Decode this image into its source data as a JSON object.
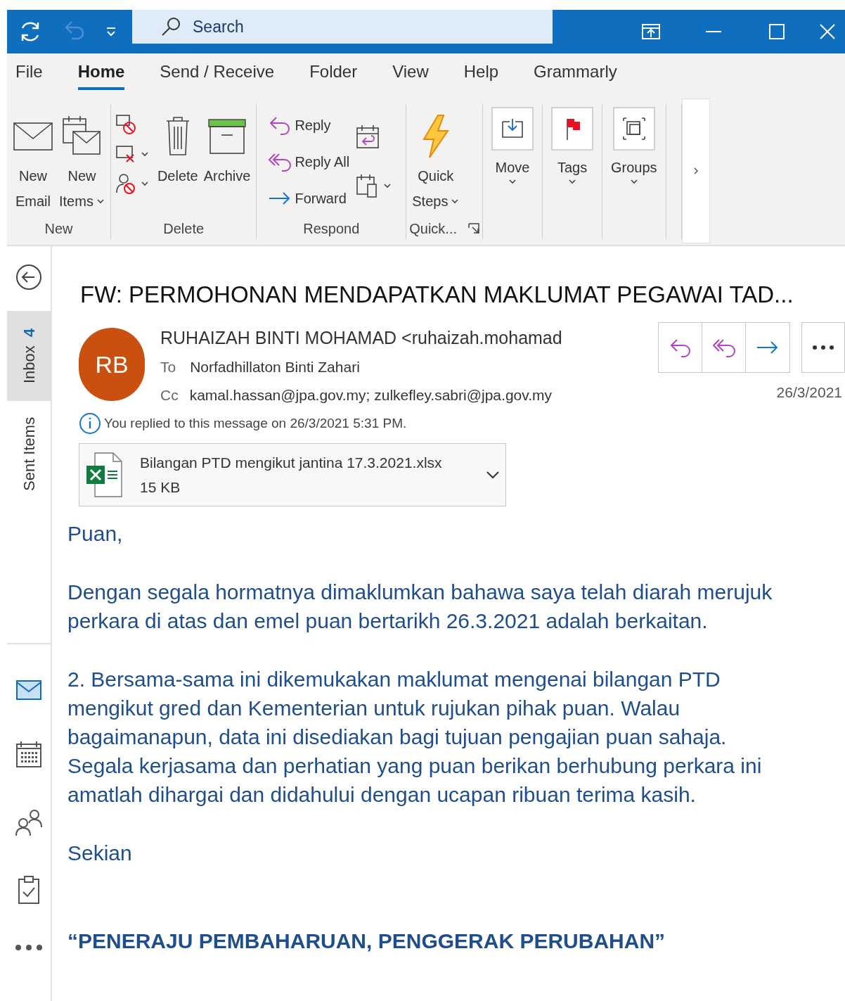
{
  "search": {
    "placeholder": "Search"
  },
  "ribbon_tabs": [
    {
      "label": "File",
      "selected": false
    },
    {
      "label": "Home",
      "selected": true
    },
    {
      "label": "Send / Receive",
      "selected": false
    },
    {
      "label": "Folder",
      "selected": false
    },
    {
      "label": "View",
      "selected": false
    },
    {
      "label": "Help",
      "selected": false
    },
    {
      "label": "Grammarly",
      "selected": false
    }
  ],
  "ribbon_groups": [
    {
      "label": "New",
      "items": [
        {
          "kind": "large",
          "lines": [
            "New",
            "Email"
          ],
          "dropdown": false
        },
        {
          "kind": "large",
          "lines": [
            "New",
            "Items"
          ],
          "dropdown": true
        }
      ]
    },
    {
      "label": "Delete",
      "items": [
        {
          "kind": "stack"
        },
        {
          "kind": "large",
          "lines": [
            "Delete"
          ],
          "dropdown": false
        },
        {
          "kind": "large",
          "lines": [
            "Archive"
          ],
          "dropdown": false
        }
      ]
    },
    {
      "label": "Respond",
      "items": [
        {
          "kind": "respond",
          "lines": [
            "Reply",
            "Reply All",
            "Forward"
          ]
        },
        {
          "kind": "stack2"
        }
      ]
    },
    {
      "label": "Quick...",
      "launcher": true,
      "items": [
        {
          "kind": "large",
          "lines": [
            "Quick",
            "Steps"
          ],
          "dropdown": true
        }
      ]
    },
    {
      "items": [
        {
          "kind": "boxed",
          "lines": [
            "Move"
          ],
          "dropdown": true
        }
      ]
    },
    {
      "items": [
        {
          "kind": "boxed",
          "lines": [
            "Tags"
          ],
          "dropdown": true
        }
      ]
    },
    {
      "items": [
        {
          "kind": "boxed",
          "lines": [
            "Groups"
          ],
          "dropdown": true
        }
      ]
    }
  ],
  "nav_folders": [
    {
      "label": "Inbox",
      "count": "4",
      "selected": true
    },
    {
      "label": "Sent Items",
      "selected": false
    }
  ],
  "nav_modules": [
    {
      "kind": "mail",
      "selected": true
    },
    {
      "kind": "calendar",
      "selected": false
    },
    {
      "kind": "people",
      "selected": false
    },
    {
      "kind": "tasks",
      "selected": false
    },
    {
      "kind": "more",
      "selected": false
    }
  ],
  "message": {
    "subject": "FW: PERMOHONAN MENDAPATKAN MAKLUMAT PEGAWAI TAD...",
    "initials": "RB",
    "sender": "RUHAIZAH BINTI MOHAMAD <ruhaizah.mohamad",
    "to_label": "To",
    "to": "Norfadhillaton Binti Zahari",
    "cc_label": "Cc",
    "cc": "kamal.hassan@jpa.gov.my; zulkefley.sabri@jpa.gov.my",
    "date": "26/3/2021",
    "info": "You replied to this message on 26/3/2021 5:31 PM.",
    "attachment": {
      "name": "Bilangan PTD mengikut jantina 17.3.2021.xlsx",
      "size": "15 KB"
    },
    "body": [
      {
        "kind": "text",
        "text": "Puan,"
      },
      {
        "kind": "text",
        "text": "Dengan segala hormatnya dimaklumkan bahawa saya telah diarah merujuk perkara di atas dan emel puan bertarikh 26.3.2021 adalah berkaitan."
      },
      {
        "kind": "text",
        "text": "2. Bersama-sama ini dikemukakan maklumat mengenai bilangan PTD mengikut gred dan Kementerian untuk rujukan pihak puan. Walau bagaimanapun, data ini disediakan bagi tujuan pengajian puan sahaja. Segala kerjasama dan perhatian yang puan berikan berhubung perkara ini amatlah dihargai dan didahului dengan ucapan ribuan terima kasih."
      },
      {
        "kind": "text",
        "text": "Sekian"
      },
      {
        "kind": "motto",
        "text": "“PENERAJU PEMBAHARUAN, PENGGERAK PERUBAHAN”"
      }
    ]
  }
}
